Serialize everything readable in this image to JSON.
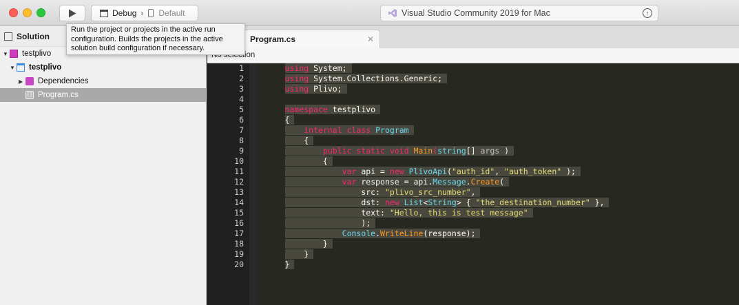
{
  "window": {
    "status_text": "Visual Studio Community 2019 for Mac",
    "run_tooltip": "Run the project or projects in the active run configuration. Builds the projects in the active solution build configuration if necessary."
  },
  "toolbar": {
    "configuration": "Debug",
    "separator": "›",
    "device": "Default"
  },
  "sidebar": {
    "title": "Solution",
    "items": [
      {
        "label": "testplivo",
        "kind": "solution"
      },
      {
        "label": "testplivo",
        "kind": "project"
      },
      {
        "label": "Dependencies",
        "kind": "dependencies"
      },
      {
        "label": "Program.cs",
        "kind": "file"
      }
    ]
  },
  "editor": {
    "tab_label": "Program.cs",
    "path_text": "No selection",
    "line_numbers": [
      "1",
      "2",
      "3",
      "4",
      "5",
      "6",
      "7",
      "8",
      "9",
      "10",
      "11",
      "12",
      "13",
      "14",
      "15",
      "16",
      "17",
      "18",
      "19",
      "20"
    ],
    "code_lines": [
      [
        [
          "k",
          "using"
        ],
        [
          "",
          "System;"
        ]
      ],
      [
        [
          "k",
          "using"
        ],
        [
          "",
          "System.Collections.Generic;"
        ]
      ],
      [
        [
          "k",
          "using"
        ],
        [
          "",
          "Plivo;"
        ]
      ],
      [],
      [
        [
          "k",
          "namespace"
        ],
        [
          "",
          "testplivo"
        ]
      ],
      [
        [
          "",
          "{"
        ]
      ],
      [
        [
          "",
          "    "
        ],
        [
          "k",
          "internal class"
        ],
        [
          "",
          ""
        ],
        [
          "t",
          "Program"
        ]
      ],
      [
        [
          "",
          "    {"
        ]
      ],
      [
        [
          "",
          "        "
        ],
        [
          "k",
          "public static void"
        ],
        [
          "",
          ""
        ],
        [
          "f",
          "Main"
        ],
        [
          "k",
          "("
        ],
        [
          "t",
          "string"
        ],
        [
          "",
          "[] "
        ],
        [
          "p",
          "args"
        ],
        [
          "",
          ")"
        ]
      ],
      [
        [
          "",
          "        {"
        ]
      ],
      [
        [
          "",
          "            "
        ],
        [
          "k",
          "var"
        ],
        [
          "",
          "api = "
        ],
        [
          "k",
          "new"
        ],
        [
          "",
          ""
        ],
        [
          "t",
          "PlivoApi"
        ],
        [
          "",
          "("
        ],
        [
          "s",
          "\"auth_id\""
        ],
        [
          "",
          ", "
        ],
        [
          "s",
          "\"auth_token\""
        ],
        [
          "",
          ");"
        ]
      ],
      [
        [
          "",
          "            "
        ],
        [
          "k",
          "var"
        ],
        [
          "",
          "response = api."
        ],
        [
          "t",
          "Message"
        ],
        [
          "",
          "."
        ],
        [
          "f",
          "Create"
        ],
        [
          "",
          "("
        ]
      ],
      [
        [
          "",
          "                src: "
        ],
        [
          "s",
          "\"plivo_src_number\""
        ],
        [
          "",
          ","
        ]
      ],
      [
        [
          "",
          "                dst: "
        ],
        [
          "k",
          "new"
        ],
        [
          "",
          ""
        ],
        [
          "t",
          "List"
        ],
        [
          "",
          "<"
        ],
        [
          "t",
          "String"
        ],
        [
          "",
          "> { "
        ],
        [
          "s",
          "\"the_destination_number\""
        ],
        [
          "",
          " },"
        ]
      ],
      [
        [
          "",
          "                text: "
        ],
        [
          "s",
          "\"Hello, this is test message\""
        ]
      ],
      [
        [
          "",
          "                );"
        ]
      ],
      [
        [
          "",
          "            "
        ],
        [
          "t",
          "Console"
        ],
        [
          "",
          "."
        ],
        [
          "f",
          "WriteLine"
        ],
        [
          "",
          "(response);"
        ]
      ],
      [
        [
          "",
          "        }"
        ]
      ],
      [
        [
          "",
          "    }"
        ]
      ],
      [
        [
          "",
          "}"
        ]
      ]
    ]
  },
  "colors": {
    "keyword": "#f92672",
    "type": "#66d9ef",
    "function": "#fd971f",
    "string": "#e6db74",
    "selection": "#49483e",
    "editor_background": "#272822"
  }
}
